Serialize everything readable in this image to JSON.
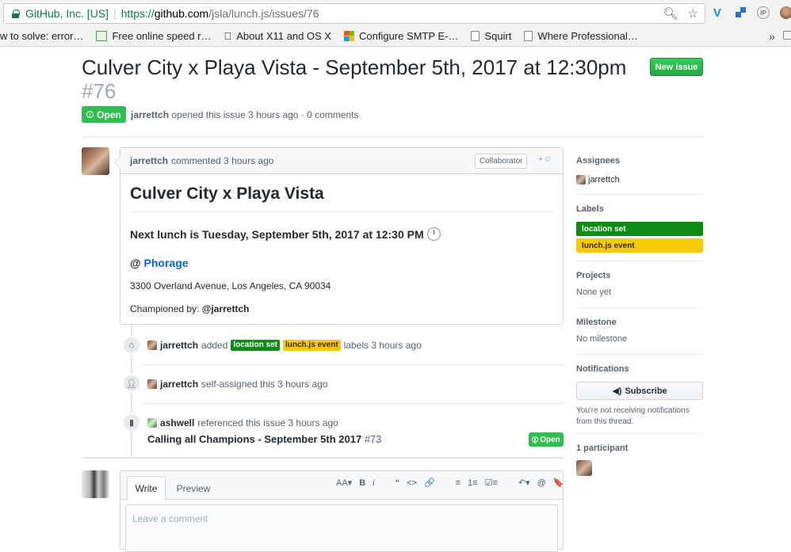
{
  "browser": {
    "site_identity": "GitHub, Inc. [US]",
    "url_protocol": "https://",
    "url_host": "github.com",
    "url_path": "/jsla/lunch.js/issues/76",
    "bookmarks": [
      {
        "label": "w to solve: error…",
        "icon": "page-icon"
      },
      {
        "label": "Free online speed r…",
        "icon": "book-icon"
      },
      {
        "label": "About X11 and OS X",
        "icon": "apple-icon"
      },
      {
        "label": "Configure SMTP E-…",
        "icon": "microsoft-icon"
      },
      {
        "label": "Squirt",
        "icon": "page-icon"
      },
      {
        "label": "Where Professional…",
        "icon": "page-icon"
      }
    ],
    "more_label": "»"
  },
  "issue": {
    "title": "Culver City x Playa Vista - September 5th, 2017 at 12:30pm",
    "number": "#76",
    "new_issue_label": "New issue",
    "state": "Open",
    "author": "jarrettch",
    "meta_text": " opened this issue 3 hours ago · 0 comments"
  },
  "comment": {
    "author": "jarrettch",
    "header_text": "commented 3 hours ago",
    "role_badge": "Collaborator",
    "heading": "Culver City x Playa Vista",
    "lunch_line": "Next lunch is Tuesday, September 5th, 2017 at 12:30 PM",
    "at_prefix": "@",
    "venue": "Phorage",
    "address": "3300 Overland Avenue, Los Angeles, CA 90034",
    "champion_prefix": "Championed by: ",
    "champion": "@jarrettch"
  },
  "timeline": {
    "labels_event": {
      "actor": "jarrettch",
      "verb": "added",
      "label1": "location set",
      "label2": "lunch.js event",
      "suffix": "labels 3 hours ago"
    },
    "assign_event": {
      "actor": "jarrettch",
      "text": "self-assigned this 3 hours ago"
    },
    "ref_event": {
      "actor": "ashwell",
      "text": "referenced this issue 3 hours ago",
      "ref_title": "Calling all Champions - September 5th 2017",
      "ref_number": "#73",
      "ref_state": "Open"
    }
  },
  "composer": {
    "tab_write": "Write",
    "tab_preview": "Preview",
    "placeholder": "Leave a comment",
    "toolbar": [
      "AA▾",
      "B",
      "i",
      "“",
      "<>",
      "🔗",
      "≡",
      "1≡",
      "☑≡",
      "↶▾",
      "@",
      "🔖"
    ]
  },
  "sidebar": {
    "assignees_title": "Assignees",
    "assignee": "jarrettch",
    "labels_title": "Labels",
    "label1": "location set",
    "label2": "lunch.js event",
    "projects_title": "Projects",
    "projects_value": "None yet",
    "milestone_title": "Milestone",
    "milestone_value": "No milestone",
    "notifications_title": "Notifications",
    "subscribe_label": "Subscribe",
    "notif_note": "You're not receiving notifications from this thread.",
    "participants_title": "1 participant"
  },
  "colors": {
    "open_green": "#2cbe4e",
    "label_location_set": "#0e8a16",
    "label_lunch_event": "#fbca04",
    "link_blue": "#0366d6"
  }
}
